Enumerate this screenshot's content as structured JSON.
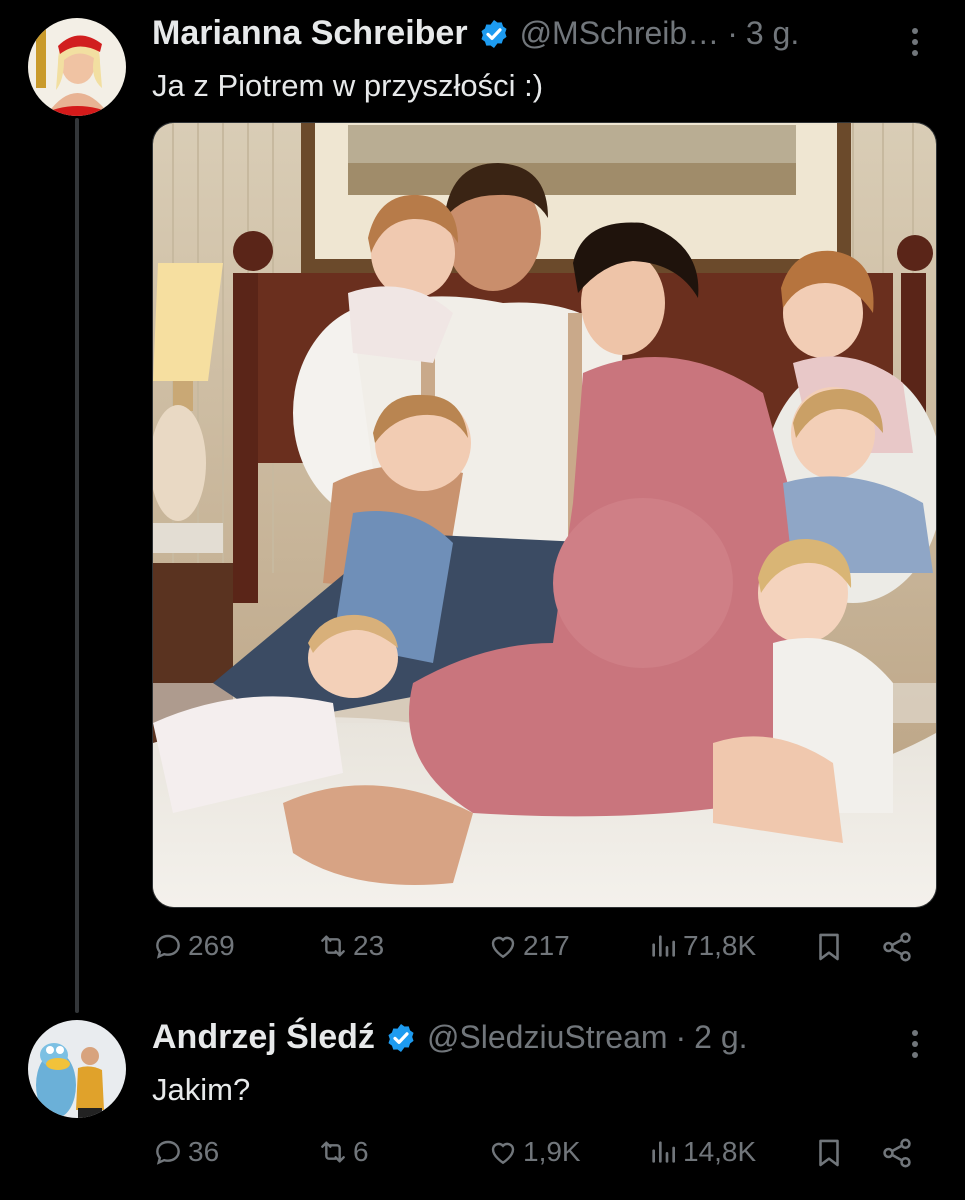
{
  "tweets": [
    {
      "author_name": "Marianna Schreiber",
      "handle": "@MSchreib…",
      "separator": "·",
      "time": "3 g.",
      "text": "Ja z Piotrem w przyszłości :)",
      "verified": true,
      "has_image": true,
      "stats": {
        "replies": "269",
        "retweets": "23",
        "likes": "217",
        "views": "71,8K"
      }
    },
    {
      "author_name": "Andrzej Śledź",
      "handle": "@SledziuStream",
      "separator": "·",
      "time": "2 g.",
      "text": "Jakim?",
      "verified": true,
      "has_image": false,
      "stats": {
        "replies": "36",
        "retweets": "6",
        "likes": "1,9K",
        "views": "14,8K"
      }
    }
  ],
  "colors": {
    "background": "#000000",
    "text": "#e7e9ea",
    "muted": "#71767b",
    "verified": "#1d9bf0"
  },
  "icons": [
    "reply-icon",
    "retweet-icon",
    "like-icon",
    "views-icon",
    "bookmark-icon",
    "share-icon",
    "more-icon",
    "verified-badge-icon"
  ]
}
